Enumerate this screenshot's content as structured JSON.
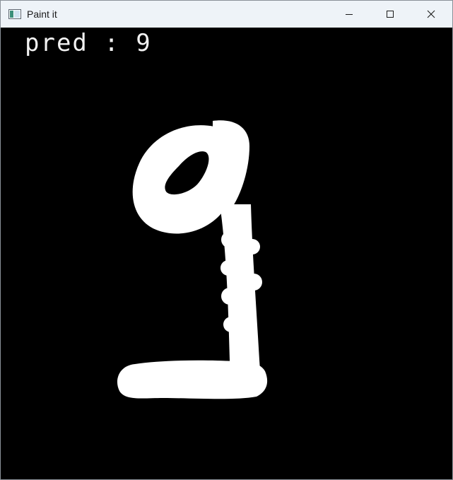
{
  "window": {
    "title": "Paint it",
    "icon": "app-window-icon"
  },
  "title_controls": [
    {
      "name": "minimize-icon",
      "label": "Minimize"
    },
    {
      "name": "maximize-icon",
      "label": "Maximize"
    },
    {
      "name": "close-icon",
      "label": "Close"
    }
  ],
  "canvas": {
    "background": "#000000",
    "stroke_color": "#ffffff",
    "prediction_text": "pred : 9",
    "drawn_content": "handwritten digit 9"
  }
}
